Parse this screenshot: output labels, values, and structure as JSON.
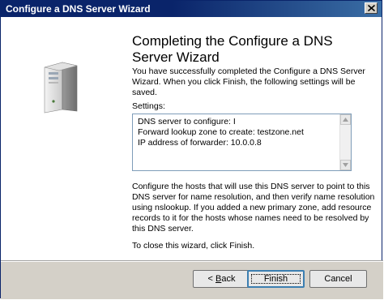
{
  "window": {
    "title": "Configure a DNS Server Wizard"
  },
  "page": {
    "heading": "Completing the Configure a DNS Server Wizard",
    "intro": "You have successfully completed the Configure a DNS Server Wizard. When you click Finish, the following settings will be saved.",
    "settings_label": "Settings:",
    "settings_lines": [
      "DNS server to configure: I",
      "Forward lookup zone to create: testzone.net",
      "IP address of forwarder: 10.0.0.8"
    ],
    "instructions": "Configure the hosts that will use this DNS server to point to this DNS server for name resolution, and then verify name resolution using nslookup. If you added a new primary zone, add resource records to it for the hosts whose names need to be resolved by this DNS server.",
    "close_note": "To close this wizard, click Finish."
  },
  "buttons": {
    "back_prefix": "< ",
    "back_mnemonic": "B",
    "back_rest": "ack",
    "finish": "Finish",
    "cancel": "Cancel"
  },
  "icons": {
    "close": "close-icon",
    "server": "server-tower-icon",
    "scroll_up": "scroll-up-arrow-icon",
    "scroll_down": "scroll-down-arrow-icon"
  }
}
